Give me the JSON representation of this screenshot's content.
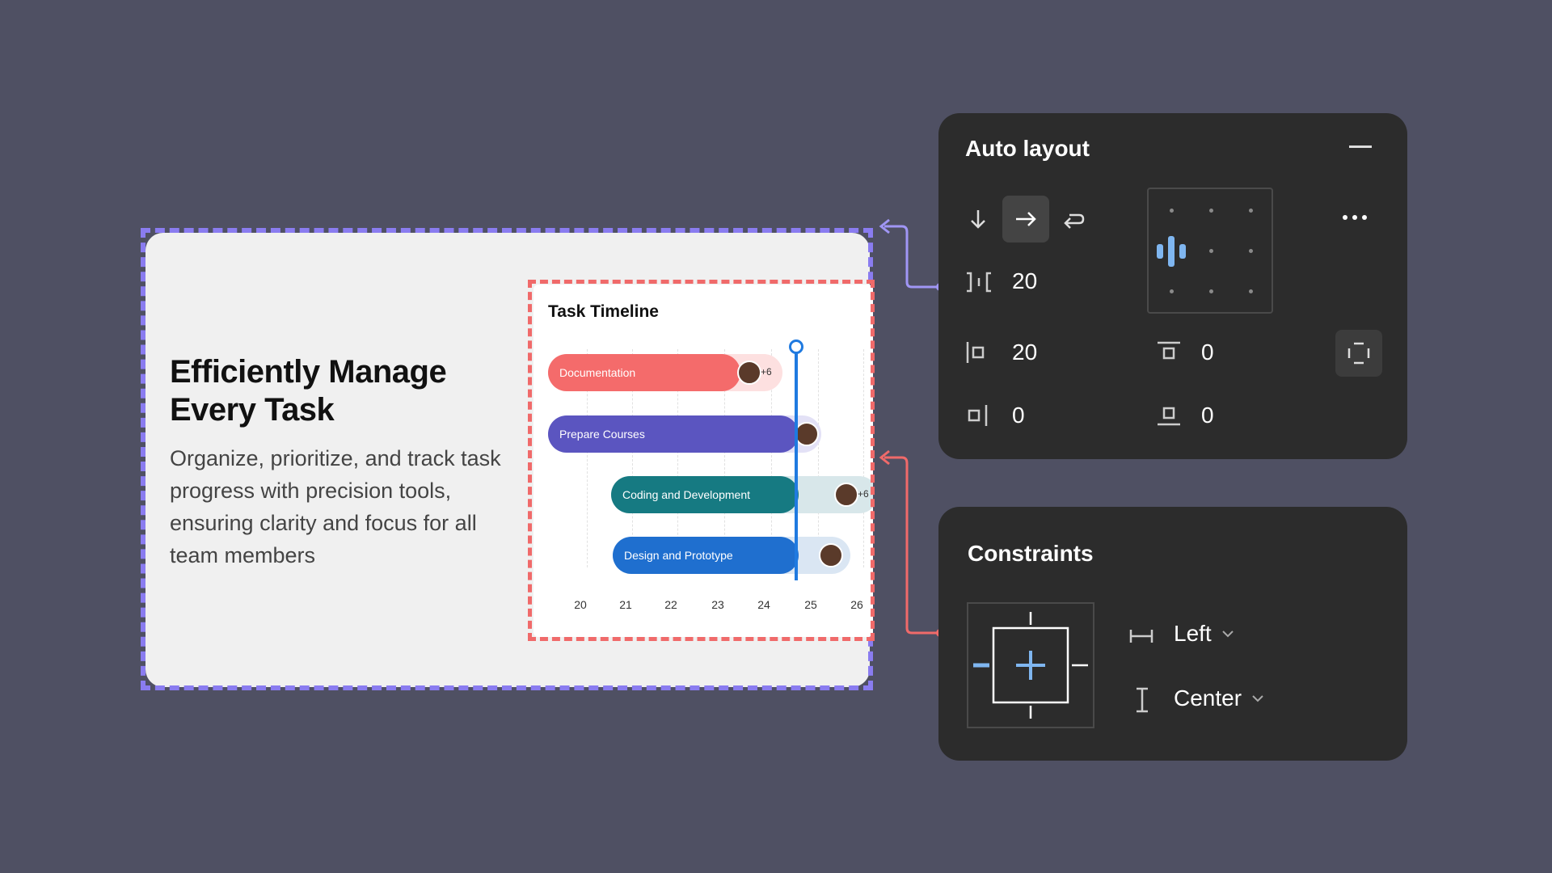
{
  "card": {
    "title_line1": "Efficiently Manage",
    "title_line2": "Every Task",
    "description": "Organize, prioritize, and track task progress with precision tools, ensuring clarity and focus for all team members"
  },
  "timeline": {
    "title": "Task Timeline",
    "tasks": [
      {
        "label": "Documentation",
        "color": "#f46b6b",
        "track_color": "#fde0e0",
        "extra": "+6"
      },
      {
        "label": "Prepare Courses",
        "color": "#5b55c0",
        "track_color": "#e3e1f6",
        "extra": ""
      },
      {
        "label": "Coding and Development",
        "color": "#167a82",
        "track_color": "#d8e7ea",
        "extra": "+6"
      },
      {
        "label": "Design and Prototype",
        "color": "#1f6fcf",
        "track_color": "#dae6f3",
        "extra": ""
      }
    ],
    "days": [
      "20",
      "21",
      "22",
      "23",
      "24",
      "25",
      "26"
    ]
  },
  "auto_layout": {
    "title": "Auto layout",
    "gap": "20",
    "padding_left": "20",
    "padding_top": "0",
    "padding_right": "0",
    "padding_bottom": "0",
    "accent": "#7fb6f0"
  },
  "constraints": {
    "title": "Constraints",
    "horizontal": "Left",
    "vertical": "Center"
  },
  "colors": {
    "background": "#4f5063",
    "card_selection": "#8a7cf0",
    "timeline_selection": "#f06a6a",
    "panel": "#2c2c2c",
    "today": "#1f7ae0"
  }
}
